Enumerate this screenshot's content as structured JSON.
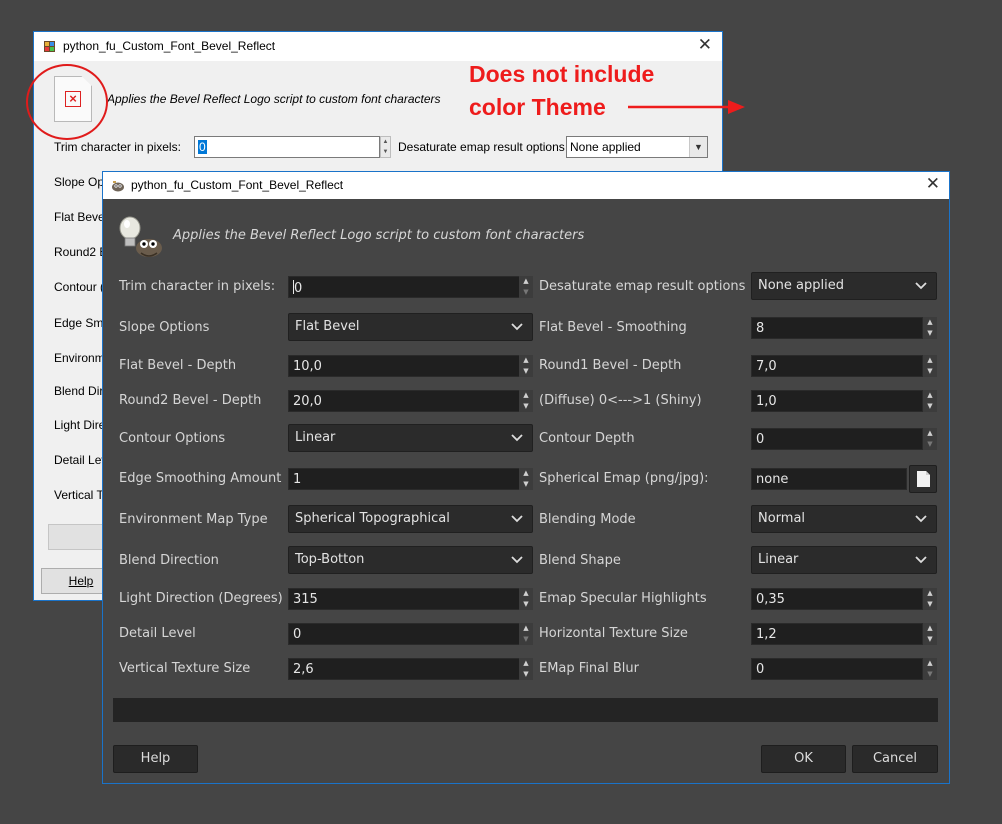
{
  "light_dialog": {
    "title": "python_fu_Custom_Font_Bevel_Reflect",
    "description": "Applies the Bevel Reflect Logo script to custom font characters",
    "trim_label": "Trim character in pixels:",
    "trim_value": "0",
    "desaturate_label": "Desaturate emap result options",
    "desaturate_value": "None applied",
    "partial_labels": [
      "Slope Op",
      "Flat Beve",
      "Round2 B",
      "Contour (",
      "Edge Smo",
      "Environm",
      "Blend Dir",
      "Light Dire",
      "Detail Lev",
      "Vertical T"
    ],
    "help_label": "Help"
  },
  "annotation": {
    "line1": "Does not include",
    "line2": "color Theme",
    "color": "#ee1c1c"
  },
  "dark_dialog": {
    "title": "python_fu_Custom_Font_Bevel_Reflect",
    "description": "Applies the Bevel Reflect Logo script to custom font characters",
    "trim": {
      "label": "Trim character in pixels:",
      "value": "0"
    },
    "desaturate": {
      "label": "Desaturate emap result options",
      "value": "None applied"
    },
    "slope": {
      "label": "Slope Options",
      "value": "Flat Bevel"
    },
    "flat_smoothing": {
      "label": "Flat Bevel - Smoothing",
      "value": "8"
    },
    "flat_depth": {
      "label": "Flat Bevel - Depth",
      "value": "10,0"
    },
    "round1_depth": {
      "label": "Round1 Bevel - Depth",
      "value": "7,0"
    },
    "round2_depth": {
      "label": "Round2 Bevel - Depth",
      "value": "20,0"
    },
    "diffuse_shiny": {
      "label": "(Diffuse) 0<--->1 (Shiny)",
      "value": "1,0"
    },
    "contour": {
      "label": "Contour Options",
      "value": "Linear"
    },
    "contour_depth": {
      "label": "Contour Depth",
      "value": "0"
    },
    "edge_smoothing": {
      "label": "Edge Smoothing Amount",
      "value": "1"
    },
    "spherical_emap": {
      "label": "Spherical Emap (png/jpg):",
      "value": "none"
    },
    "env_map_type": {
      "label": "Environment Map Type",
      "value": "Spherical Topographical"
    },
    "blending_mode": {
      "label": "Blending Mode",
      "value": "Normal"
    },
    "blend_direction": {
      "label": "Blend Direction",
      "value": "Top-Botton"
    },
    "blend_shape": {
      "label": "Blend Shape",
      "value": "Linear"
    },
    "light_direction": {
      "label": "Light Direction (Degrees)",
      "value": "315"
    },
    "emap_specular": {
      "label": "Emap Specular Highlights",
      "value": "0,35"
    },
    "detail_level": {
      "label": "Detail Level",
      "value": "0"
    },
    "horizontal_texture": {
      "label": "Horizontal Texture Size",
      "value": "1,2"
    },
    "vertical_texture": {
      "label": "Vertical Texture Size",
      "value": "2,6"
    },
    "emap_final_blur": {
      "label": "EMap Final Blur",
      "value": "0"
    },
    "buttons": {
      "help": "Help",
      "ok": "OK",
      "cancel": "Cancel"
    }
  }
}
